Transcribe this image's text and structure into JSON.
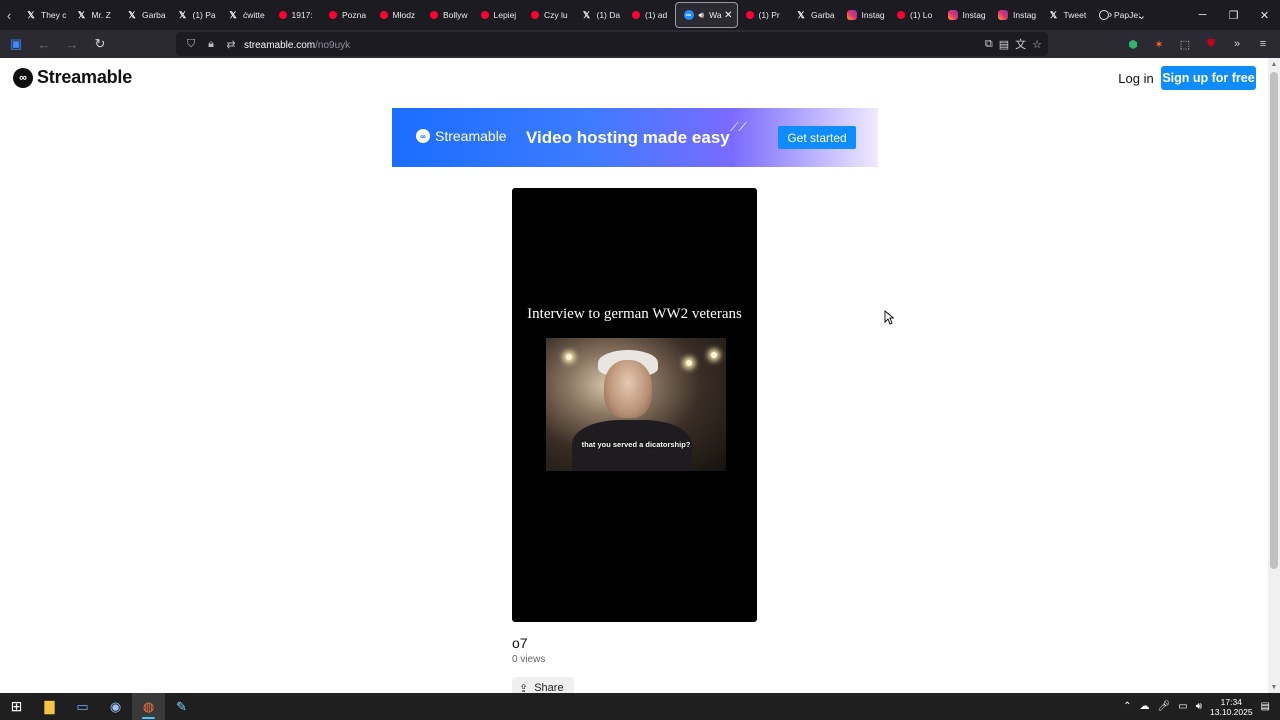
{
  "browser": {
    "tabs": [
      {
        "title": "They c",
        "icon": "x-icon"
      },
      {
        "title": "Mr. Z",
        "icon": "x-icon"
      },
      {
        "title": "Garba",
        "icon": "x-icon"
      },
      {
        "title": "(1) Pa",
        "icon": "x-icon"
      },
      {
        "title": "ćwitte",
        "icon": "x-icon"
      },
      {
        "title": "1917:",
        "icon": "youtube-icon"
      },
      {
        "title": "Pozna",
        "icon": "youtube-icon"
      },
      {
        "title": "Młodz",
        "icon": "youtube-icon"
      },
      {
        "title": "Bollyw",
        "icon": "youtube-icon"
      },
      {
        "title": "Lepiej",
        "icon": "youtube-icon"
      },
      {
        "title": "Czy lu",
        "icon": "youtube-icon"
      },
      {
        "title": "(1) Da",
        "icon": "x-icon"
      },
      {
        "title": "(1) ad",
        "icon": "youtube-icon"
      },
      {
        "title": "Wa",
        "icon": "streamable-icon",
        "active": true
      },
      {
        "title": "(1) Pr",
        "icon": "youtube-icon"
      },
      {
        "title": "Garba",
        "icon": "x-icon"
      },
      {
        "title": "Instag",
        "icon": "instagram-icon"
      },
      {
        "title": "(1) Lo",
        "icon": "youtube-icon"
      },
      {
        "title": "Instag",
        "icon": "instagram-icon"
      },
      {
        "title": "Instag",
        "icon": "instagram-icon"
      },
      {
        "title": "Tweet",
        "icon": "x-icon"
      },
      {
        "title": "PapJe:",
        "icon": "pp-icon"
      }
    ],
    "url_host": "streamable.com",
    "url_path": "/no9uyk"
  },
  "site": {
    "brand": "Streamable",
    "login_label": "Log in",
    "signup_label": "Sign up for free",
    "banner": {
      "brand": "Streamable",
      "tagline": "Video hosting made easy",
      "cta": "Get started"
    },
    "video": {
      "overlay_caption": "Interview to german WW2 veterans",
      "subtitle": "that you served a dicatorship?",
      "title": "o7",
      "views": "0 views",
      "share_label": "Share"
    }
  },
  "taskbar": {
    "time": "17:34",
    "date": "13.10.2025"
  },
  "colors": {
    "accent": "#0f8cff",
    "browser_chrome": "#1c1b22"
  }
}
